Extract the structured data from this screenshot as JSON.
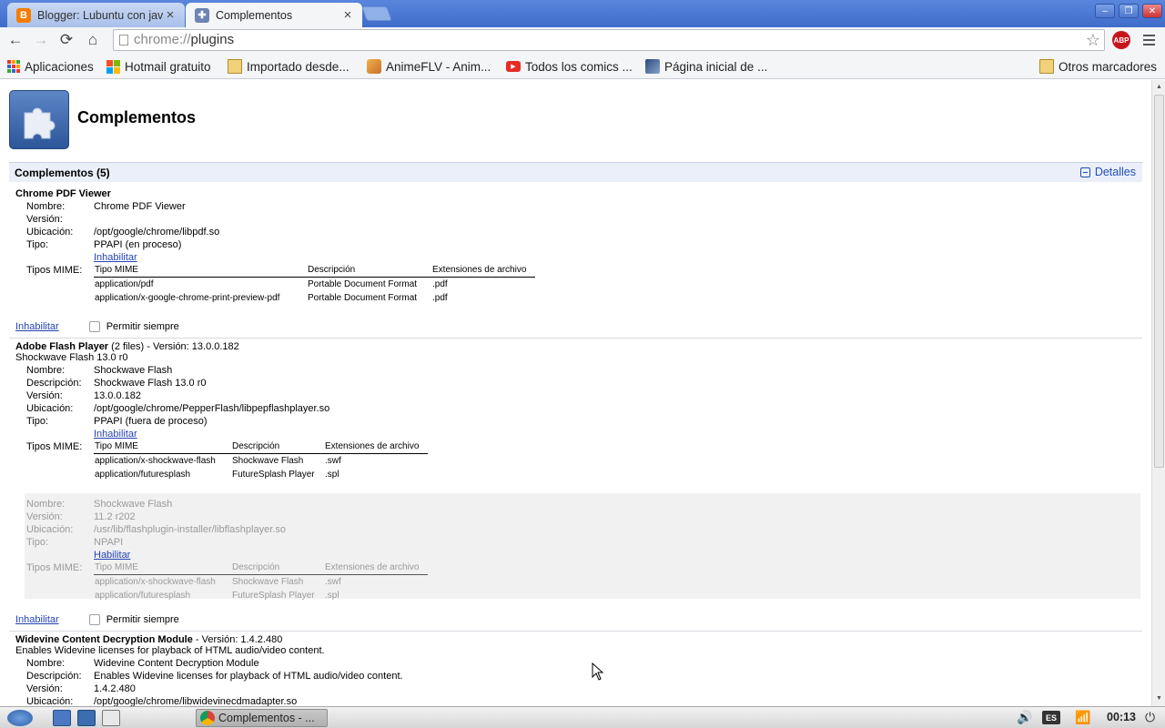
{
  "tabs": [
    {
      "title": "Blogger: Lubuntu con javi",
      "close": "×",
      "icon": "blogger-icon"
    },
    {
      "title": "Complementos",
      "close": "×",
      "icon": "puzzle-icon"
    }
  ],
  "window_controls": {
    "minimize": "–",
    "restore": "❐",
    "close": "✕"
  },
  "toolbar": {
    "back": "←",
    "forward": "→",
    "reload": "⟳",
    "home": "⌂",
    "url_scheme": "chrome://",
    "url_path": "plugins",
    "star": "☆",
    "abp": "ABP"
  },
  "bookmarks": [
    {
      "label": "Aplicaciones",
      "icon": "apps-grid-icon"
    },
    {
      "label": "Hotmail gratuito",
      "icon": "windows-icon"
    },
    {
      "label": "Importado desde...",
      "icon": "folder-icon"
    },
    {
      "label": "AnimeFLV - Anim...",
      "icon": "animeflv-icon"
    },
    {
      "label": "Todos los comics ...",
      "icon": "youtube-icon"
    },
    {
      "label": "Página inicial de ...",
      "icon": "page-icon"
    },
    {
      "label": "Otros marcadores",
      "icon": "folder-icon"
    }
  ],
  "page": {
    "title": "Complementos",
    "section_title": "Complementos (5)",
    "details_link": "Detalles"
  },
  "labels": {
    "nombre": "Nombre:",
    "version": "Versión:",
    "ubicacion": "Ubicación:",
    "tipo": "Tipo:",
    "descripcion": "Descripción:",
    "tipos_mime": "Tipos MIME:",
    "mime_col_type": "Tipo MIME",
    "mime_col_desc": "Descripción",
    "mime_col_ext": "Extensiones de archivo",
    "inhabilitar": "Inhabilitar",
    "habilitar": "Habilitar",
    "permitir_siempre": "Permitir siempre"
  },
  "plugins": {
    "pdf": {
      "name": "Chrome PDF Viewer",
      "nombre": "Chrome PDF Viewer",
      "version": "",
      "ubicacion": "/opt/google/chrome/libpdf.so",
      "tipo": "PPAPI (en proceso)",
      "mime": [
        {
          "type": "application/pdf",
          "desc": "Portable Document Format",
          "ext": ".pdf"
        },
        {
          "type": "application/x-google-chrome-print-preview-pdf",
          "desc": "Portable Document Format",
          "ext": ".pdf"
        }
      ]
    },
    "flash": {
      "name": "Adobe Flash Player",
      "name_suffix": " (2 files) - Versión: 13.0.0.182",
      "desc": "Shockwave Flash 13.0 r0",
      "pepper": {
        "nombre": "Shockwave Flash",
        "descripcion": "Shockwave Flash 13.0 r0",
        "version": "13.0.0.182",
        "ubicacion": "/opt/google/chrome/PepperFlash/libpepflashplayer.so",
        "tipo": "PPAPI (fuera de proceso)",
        "mime": [
          {
            "type": "application/x-shockwave-flash",
            "desc": "Shockwave Flash",
            "ext": ".swf"
          },
          {
            "type": "application/futuresplash",
            "desc": "FutureSplash Player",
            "ext": ".spl"
          }
        ]
      },
      "npapi": {
        "nombre": "Shockwave Flash",
        "version": "11.2 r202",
        "ubicacion": "/usr/lib/flashplugin-installer/libflashplayer.so",
        "tipo": "NPAPI",
        "mime": [
          {
            "type": "application/x-shockwave-flash",
            "desc": "Shockwave Flash",
            "ext": ".swf"
          },
          {
            "type": "application/futuresplash",
            "desc": "FutureSplash Player",
            "ext": ".spl"
          }
        ]
      }
    },
    "widevine": {
      "name": "Widevine Content Decryption Module",
      "name_suffix": " - Versión: 1.4.2.480",
      "desc": "Enables Widevine licenses for playback of HTML audio/video content.",
      "nombre": "Widevine Content Decryption Module",
      "descripcion": "Enables Widevine licenses for playback of HTML audio/video content.",
      "version": "1.4.2.480",
      "ubicacion": "/opt/google/chrome/libwidevinecdmadapter.so"
    }
  },
  "taskbar": {
    "task_label": "Complementos - ...",
    "lang": "ES",
    "clock": "00:13"
  }
}
